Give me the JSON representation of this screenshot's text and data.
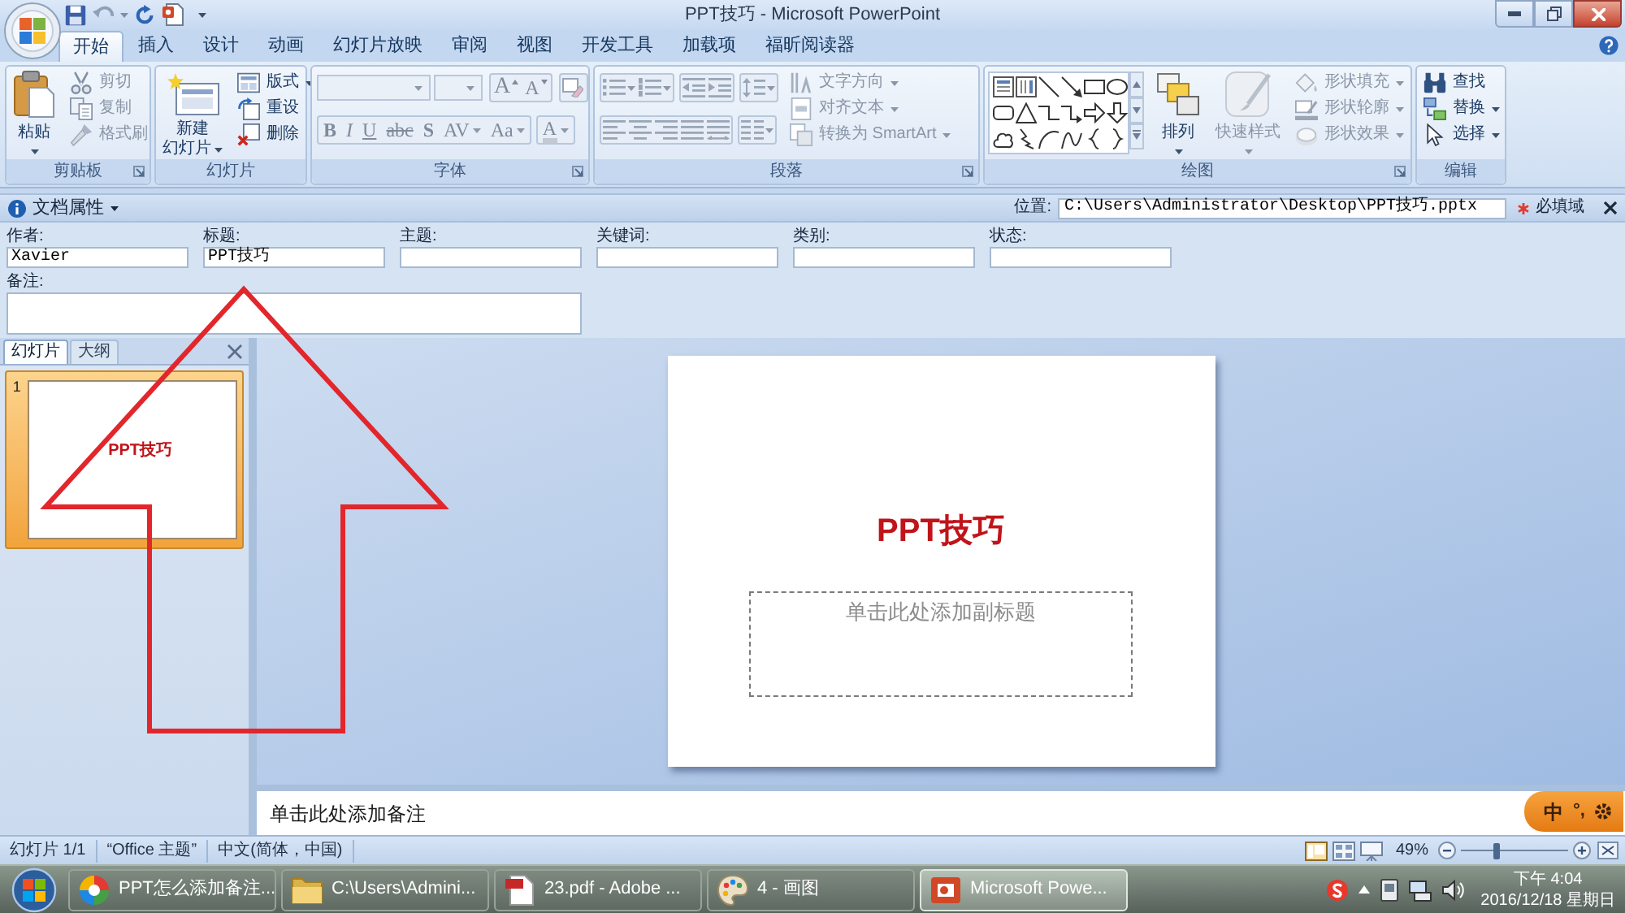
{
  "title_bar": {
    "title": "PPT技巧 - Microsoft PowerPoint"
  },
  "ribbon": {
    "tabs": [
      {
        "label": "开始",
        "selected": true
      },
      {
        "label": "插入",
        "selected": false
      },
      {
        "label": "设计",
        "selected": false
      },
      {
        "label": "动画",
        "selected": false
      },
      {
        "label": "幻灯片放映",
        "selected": false
      },
      {
        "label": "审阅",
        "selected": false
      },
      {
        "label": "视图",
        "selected": false
      },
      {
        "label": "开发工具",
        "selected": false
      },
      {
        "label": "加载项",
        "selected": false
      },
      {
        "label": "福昕阅读器",
        "selected": false
      }
    ],
    "groups": [
      {
        "label": "剪贴板",
        "launcher": true,
        "items": [
          {
            "kind": "large",
            "lines": [
              "粘贴"
            ],
            "dropdown": true,
            "disabled": false
          },
          {
            "kind": "small",
            "label": "剪切",
            "dropdown": false,
            "disabled": true
          },
          {
            "kind": "small",
            "label": "复制",
            "dropdown": false,
            "disabled": true
          },
          {
            "kind": "small",
            "label": "格式刷",
            "dropdown": false,
            "disabled": true
          }
        ]
      },
      {
        "label": "幻灯片",
        "launcher": false,
        "items": [
          {
            "kind": "large",
            "lines": [
              "新建",
              "幻灯片"
            ],
            "dropdown": true,
            "disabled": false
          },
          {
            "kind": "small",
            "label": "版式",
            "dropdown": true,
            "disabled": false
          },
          {
            "kind": "small",
            "label": "重设",
            "dropdown": false,
            "disabled": false
          },
          {
            "kind": "small",
            "label": "删除",
            "dropdown": false,
            "disabled": false
          }
        ]
      },
      {
        "label": "字体",
        "launcher": true,
        "items": [
          {
            "kind": "font-panel",
            "disabled": true,
            "size_buttons": [
              "A",
              "A"
            ],
            "format_buttons": [
              "B",
              "I",
              "U",
              "abc",
              "S",
              "AV",
              "Aa",
              "A"
            ]
          }
        ]
      },
      {
        "label": "段落",
        "launcher": true,
        "items": [
          {
            "kind": "paragraph-panel",
            "disabled": true
          },
          {
            "kind": "small",
            "label": "文字方向",
            "dropdown": true,
            "disabled": true
          },
          {
            "kind": "small",
            "label": "对齐文本",
            "dropdown": true,
            "disabled": true
          },
          {
            "kind": "small",
            "label": "转换为 SmartArt",
            "dropdown": true,
            "disabled": true
          }
        ]
      },
      {
        "label": "绘图",
        "launcher": true,
        "items": [
          {
            "kind": "shape-gallery"
          },
          {
            "kind": "large",
            "lines": [
              "排列"
            ],
            "dropdown": true,
            "disabled": false
          },
          {
            "kind": "large",
            "lines": [
              "快速样式"
            ],
            "dropdown": true,
            "disabled": true
          },
          {
            "kind": "small",
            "label": "形状填充",
            "dropdown": true,
            "disabled": true
          },
          {
            "kind": "small",
            "label": "形状轮廓",
            "dropdown": true,
            "disabled": true
          },
          {
            "kind": "small",
            "label": "形状效果",
            "dropdown": true,
            "disabled": true
          }
        ]
      },
      {
        "label": "编辑",
        "launcher": false,
        "items": [
          {
            "kind": "small",
            "label": "查找",
            "dropdown": false,
            "disabled": false
          },
          {
            "kind": "small",
            "label": "替换",
            "dropdown": true,
            "disabled": false
          },
          {
            "kind": "small",
            "label": "选择",
            "dropdown": true,
            "disabled": false
          }
        ]
      }
    ]
  },
  "document_properties": {
    "title": "文档属性",
    "location_label": "位置:",
    "location": "C:\\Users\\Administrator\\Desktop\\PPT技巧.pptx",
    "required_note": "必填域",
    "fields": [
      {
        "label": "作者:",
        "value": "Xavier"
      },
      {
        "label": "标题:",
        "value": "PPT技巧"
      },
      {
        "label": "主题:"
      },
      {
        "label": "关键词:"
      },
      {
        "label": "类别:"
      },
      {
        "label": "状态:"
      }
    ],
    "comments": {
      "label": "备注:"
    }
  },
  "slides_pane": {
    "tabs": [
      {
        "label": "幻灯片",
        "selected": true
      },
      {
        "label": "大纲",
        "selected": false
      }
    ],
    "thumbnails": [
      {
        "number": "1",
        "title": "PPT技巧",
        "selected": true
      }
    ]
  },
  "slide": {
    "title": "PPT技巧",
    "subtitle_placeholder": "单击此处添加副标题"
  },
  "notes": {
    "prompt": "单击此处添加备注"
  },
  "status_bar": {
    "items": [
      "幻灯片 1/1",
      "“Office 主题”",
      "中文(简体，中国)"
    ],
    "zoom": "49%",
    "zoom_slider": {
      "level": 0.33
    }
  },
  "ime_toolbar": {
    "mode": "中",
    "punctuation": "°,"
  },
  "taskbar": {
    "items": [
      {
        "label": "PPT怎么添加备注...",
        "selected": false
      },
      {
        "label": "C:\\Users\\Admini...",
        "selected": false
      },
      {
        "label": "23.pdf - Adobe ...",
        "selected": false
      },
      {
        "label": "4 - 画图",
        "selected": false
      },
      {
        "label": "Microsoft Powe...",
        "selected": true
      }
    ],
    "clock": {
      "time": "下午 4:04",
      "date": "2016/12/18 星期日"
    }
  },
  "annotation": {
    "kind": "up-arrow"
  }
}
